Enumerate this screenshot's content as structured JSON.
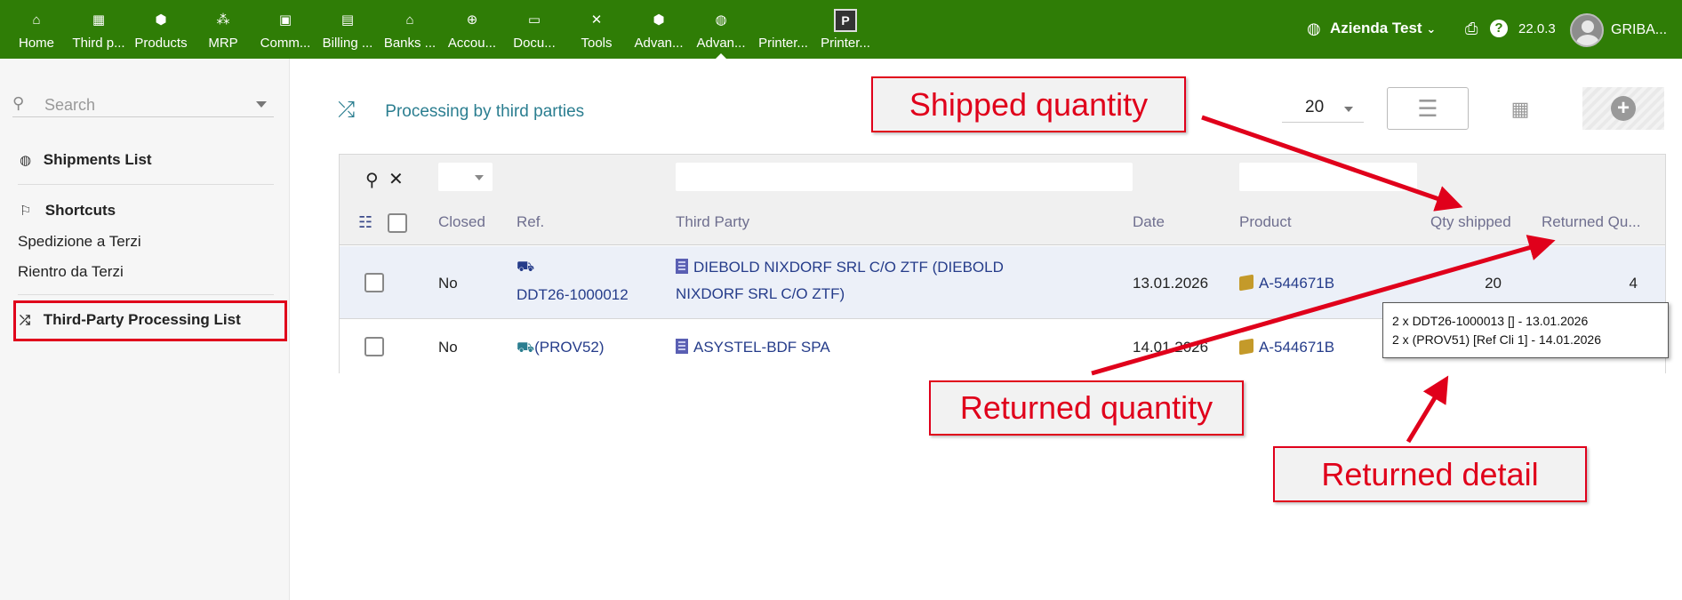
{
  "topbar": {
    "menu": [
      {
        "label": "Home",
        "icon": "house-icon",
        "glyph": "⌂"
      },
      {
        "label": "Third p...",
        "icon": "building-icon",
        "glyph": "▦"
      },
      {
        "label": "Products",
        "icon": "cube-icon",
        "glyph": "⬢"
      },
      {
        "label": "MRP",
        "icon": "cubes-icon",
        "glyph": "⁂"
      },
      {
        "label": "Comm...",
        "icon": "briefcase-icon",
        "glyph": "▣"
      },
      {
        "label": "Billing ...",
        "icon": "invoice-icon",
        "glyph": "▤"
      },
      {
        "label": "Banks ...",
        "icon": "bank-icon",
        "glyph": "⌂"
      },
      {
        "label": "Accou...",
        "icon": "search-dollar-icon",
        "glyph": "⊕"
      },
      {
        "label": "Docu...",
        "icon": "folder-open-icon",
        "glyph": "▭"
      },
      {
        "label": "Tools",
        "icon": "tools-icon",
        "glyph": "✕"
      },
      {
        "label": "Advan...",
        "icon": "cube-icon",
        "glyph": "⬢"
      },
      {
        "label": "Advan...",
        "icon": "globe-icon",
        "glyph": "◍"
      },
      {
        "label": "Printer...",
        "icon": "none",
        "glyph": ""
      },
      {
        "label": "Printer...",
        "icon": "printer-logo-icon",
        "glyph": "P"
      }
    ],
    "company": "Azienda Test",
    "version": "22.0.3",
    "username": "GRIBA..."
  },
  "sidebar": {
    "search_placeholder": "Search",
    "shipments_list": "Shipments List",
    "shortcuts_title": "Shortcuts",
    "shortcuts": [
      "Spedizione a Terzi",
      "Rientro da Terzi"
    ],
    "third_party_list": "Third-Party Processing List"
  },
  "main": {
    "title": "Processing by third parties",
    "limit": "20",
    "columns": {
      "closed": "Closed",
      "ref": "Ref.",
      "third_party": "Third Party",
      "date": "Date",
      "product": "Product",
      "qty_shipped": "Qty shipped",
      "returned_qty": "Returned Qu..."
    },
    "rows": [
      {
        "closed": "No",
        "ref": "DDT26-1000012",
        "third_party_line1": "DIEBOLD NIXDORF SRL C/O ZTF (DIEBOLD",
        "third_party_line2": "NIXDORF SRL C/O ZTF)",
        "date": "13.01.2026",
        "product": "A-544671B",
        "qty_shipped": "20",
        "returned_qty": "4"
      },
      {
        "closed": "No",
        "ref": "(PROV52)",
        "third_party_line1": "ASYSTEL-BDF SPA",
        "date": "14.01.2026",
        "product": "A-544671B"
      }
    ],
    "tooltip": [
      "2 x DDT26-1000013 [] - 13.01.2026",
      "2 x (PROV51) [Ref Cli 1] - 14.01.2026"
    ]
  },
  "callouts": {
    "shipped": "Shipped quantity",
    "returned": "Returned quantity",
    "detail": "Returned detail"
  },
  "colors": {
    "topbar": "#2f7d06",
    "accent": "#2b7e90",
    "annotation_red": "#e0001b",
    "link": "#253c8a"
  }
}
